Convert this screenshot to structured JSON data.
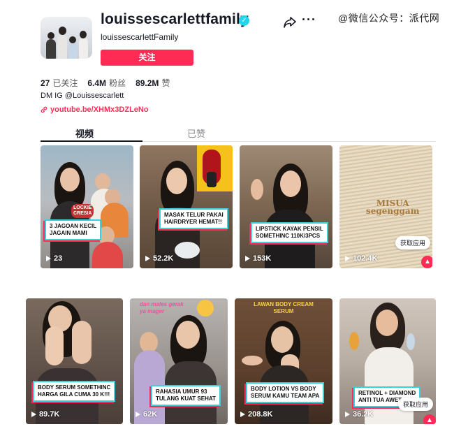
{
  "watermark": "@微信公众号：派代网",
  "profile": {
    "username": "louissescarlettfamily",
    "nickname": "louissescarlettFamily",
    "follow_label": "关注",
    "stats": [
      {
        "value": "27",
        "label": "已关注"
      },
      {
        "value": "6.4M",
        "label": "粉丝"
      },
      {
        "value": "89.2M",
        "label": "赞"
      }
    ],
    "bio": "DM IG @Louissescarlett",
    "link": "youtube.be/XHMx3DZLeNo"
  },
  "tabs": {
    "videos": "视频",
    "liked": "已赞"
  },
  "get_app_label": "获取应用",
  "videos": [
    {
      "caption": "3 JAGOAN KECIL\nJAGAIN MAMI",
      "views": "23"
    },
    {
      "caption": "MASAK TELUR PAKAI\nHAIRDRYER HEMAT!!",
      "views": "52.2K"
    },
    {
      "caption": "LIPSTICK KAYAK PENSIL\nSOMETHINC 110K/3PCS",
      "views": "153K"
    },
    {
      "caption": "MISUA\nsegenggam",
      "views": "102.4K"
    },
    {
      "caption": "BODY SERUM SOMETHINC\nHARGA GILA CUMA 30 K!!!",
      "views": "89.7K"
    },
    {
      "caption": "RAHASIA UMUR 93\nTULANG KUAT SEHAT",
      "views": "62K"
    },
    {
      "caption": "BODY LOTION VS BODY\nSERUM KAMU TEAM APA",
      "views": "208.8K"
    },
    {
      "caption": "RETINOL + DIAMOND\nANTI TUA AWET",
      "views": "36.2K"
    }
  ],
  "overlay_texts": {
    "lockie": "LOCKIE\nCRESIA",
    "lawan": "LAWAN BODY CREAM\nSERUM",
    "males": "dan males gerak\nya mager"
  },
  "colors": {
    "accent": "#fe2c55",
    "verified": "#20d5ec",
    "caption_border": "#3ad0d9"
  }
}
